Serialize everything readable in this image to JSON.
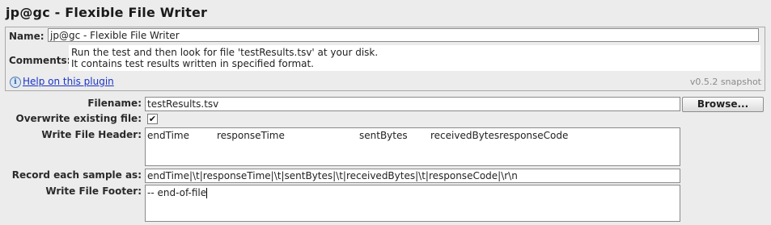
{
  "window": {
    "title": "jp@gc - Flexible File Writer"
  },
  "top_panel": {
    "name_label": "Name:",
    "name_value": "jp@gc - Flexible File Writer",
    "comments_label": "Comments:",
    "comments_line1": "Run the test and then look for file 'testResults.tsv' at your disk.",
    "comments_line2": "It contains test results written in specified format.",
    "help_link": "Help on this plugin",
    "help_icon": "info-icon",
    "version": "v0.5.2 snapshot"
  },
  "form": {
    "filename_label": "Filename:",
    "filename_value": "testResults.tsv",
    "browse_label": "Browse...",
    "overwrite_label": "Overwrite existing file:",
    "overwrite_checked": true,
    "overwrite_mark": "✔",
    "header_label": "Write File Header:",
    "header_columns": [
      "endTime",
      "responseTime",
      "sentBytes",
      "receivedBytesresponseCode"
    ],
    "record_label": "Record each sample as:",
    "record_value": "endTime|\\t|responseTime|\\t|sentBytes|\\t|receivedBytes|\\t|responseCode|\\r\\n",
    "footer_label": "Write File Footer:",
    "footer_value": "-- end-of-file"
  }
}
